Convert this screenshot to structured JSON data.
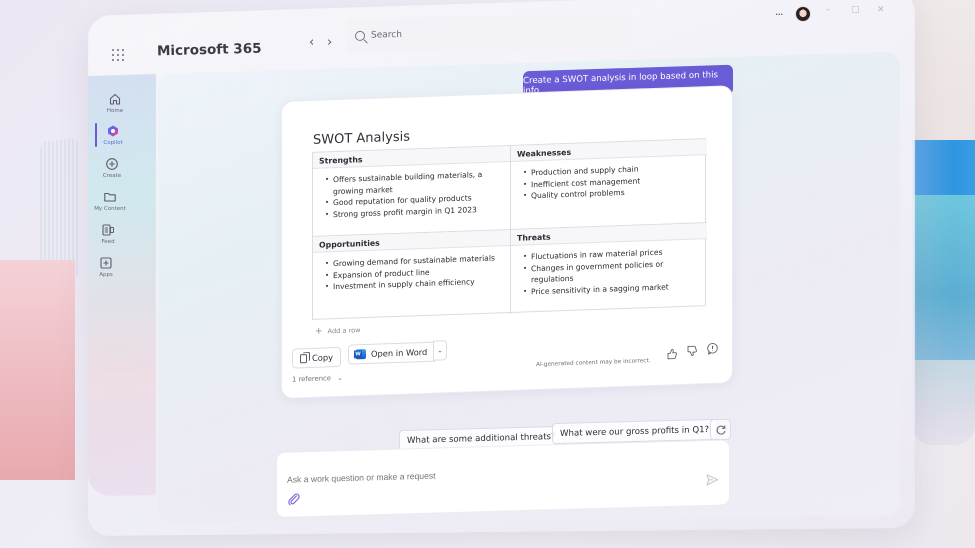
{
  "app": {
    "title": "Microsoft 365",
    "accent_color": "#6a5bd6"
  },
  "header": {
    "back_label": "‹",
    "forward_label": "›",
    "search_placeholder": "Search",
    "more_label": "···",
    "window_controls": {
      "minimize": "–",
      "maximize": "▢",
      "close": "✕"
    }
  },
  "sidebar": {
    "items": [
      {
        "label": "Home",
        "icon": "home-icon",
        "active": false
      },
      {
        "label": "Copilot",
        "icon": "copilot-icon",
        "active": true
      },
      {
        "label": "Create",
        "icon": "plus-circle-icon",
        "active": false
      },
      {
        "label": "My Content",
        "icon": "folder-icon",
        "active": false
      },
      {
        "label": "Feed",
        "icon": "feed-icon",
        "active": false
      },
      {
        "label": "Apps",
        "icon": "apps-icon",
        "active": false
      }
    ]
  },
  "chat": {
    "user_prompt": "Create a SWOT analysis in loop based on this info",
    "response": {
      "title": "SWOT Analysis",
      "quadrants": [
        {
          "heading": "Strengths",
          "items": [
            "Offers sustainable building materials, a growing market",
            "Good reputation for quality products",
            "Strong gross profit margin in Q1 2023"
          ]
        },
        {
          "heading": "Weaknesses",
          "items": [
            "Production and supply chain",
            "Inefficient cost management",
            "Quality control problems"
          ]
        },
        {
          "heading": "Opportunities",
          "items": [
            "Growing demand for sustainable materials",
            "Expansion of product line",
            "Investment in supply chain efficiency"
          ]
        },
        {
          "heading": "Threats",
          "items": [
            "Fluctuations in raw material prices",
            "Changes in government policies or regulations",
            "Price sensitivity in a sagging market"
          ]
        }
      ],
      "add_row_label": "Add a row",
      "copy_label": "Copy",
      "open_in_word_label": "Open in Word",
      "reference_label": "1 reference",
      "disclaimer": "AI-generated content may be incorrect."
    },
    "suggestions": [
      "What are some additional threats?",
      "What were our gross profits in Q1?"
    ]
  },
  "composer": {
    "placeholder": "Ask a work question or make a request"
  }
}
